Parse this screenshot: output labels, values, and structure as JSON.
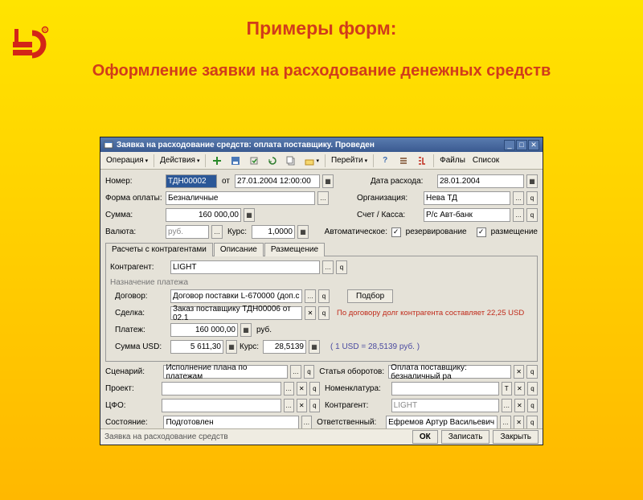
{
  "slide": {
    "title": "Примеры форм:",
    "subtitle": "Оформление заявки на расходование денежных средств"
  },
  "win": {
    "title": "Заявка на расходование средств: оплата поставщику. Проведен"
  },
  "toolbar": {
    "operation": "Операция",
    "actions": "Действия",
    "goto": "Перейти",
    "files": "Файлы",
    "list": "Список"
  },
  "fields": {
    "number_lbl": "Номер:",
    "number": "ТДН00002",
    "date_lbl": "от",
    "date": "27.01.2004 12:00:00",
    "expdate_lbl": "Дата расхода:",
    "expdate": "28.01.2004",
    "payform_lbl": "Форма оплаты:",
    "payform": "Безналичные",
    "org_lbl": "Организация:",
    "org": "Нева ТД",
    "sum_lbl": "Сумма:",
    "sum": "160 000,00",
    "account_lbl": "Счет / Касса:",
    "account": "Р/с Авт-банк",
    "currency_lbl": "Валюта:",
    "currency": "руб.",
    "rate_lbl": "Курс:",
    "rate": "1,0000",
    "auto_lbl": "Автоматическое:",
    "reserve": "резервирование",
    "place": "размещение"
  },
  "tabs": {
    "t1": "Расчеты с контрагентами",
    "t2": "Описание",
    "t3": "Размещение"
  },
  "pane": {
    "contragent_lbl": "Контрагент:",
    "contragent": "LIGHT",
    "section": "Назначение платежа",
    "contract_lbl": "Договор:",
    "contract": "Договор поставки L-670000 (доп.с",
    "podbor": "Подбор",
    "deal_lbl": "Сделка:",
    "deal": "Заказ поставщику ТДН00006 от 02.1",
    "note": "По договору долг контрагента составляет 22,25 USD",
    "payment_lbl": "Платеж:",
    "payment": "160 000,00",
    "payment_cur": "руб.",
    "sumusd_lbl": "Сумма USD:",
    "sumusd": "5 611,30",
    "rate2_lbl": "Курс:",
    "rate2": "28,5139",
    "hint": "( 1 USD = 28,5139 руб. )"
  },
  "bottom": {
    "scenario_lbl": "Сценарий:",
    "scenario": "Исполнение плана по платежам",
    "article_lbl": "Статья оборотов:",
    "article": "Оплата поставщику: безналичный ра",
    "project_lbl": "Проект:",
    "project": "",
    "nomen_lbl": "Номенклатура:",
    "nomen": "",
    "cfo_lbl": "ЦФО:",
    "cfo": "",
    "contr2_lbl": "Контрагент:",
    "contr2": "LIGHT",
    "state_lbl": "Состояние:",
    "state": "Подготовлен",
    "resp_lbl": "Ответственный:",
    "resp": "Ефремов Артур Васильевич"
  },
  "footer": {
    "hint": "Заявка на расходование средств",
    "ok": "ОК",
    "save": "Записать",
    "close": "Закрыть"
  }
}
